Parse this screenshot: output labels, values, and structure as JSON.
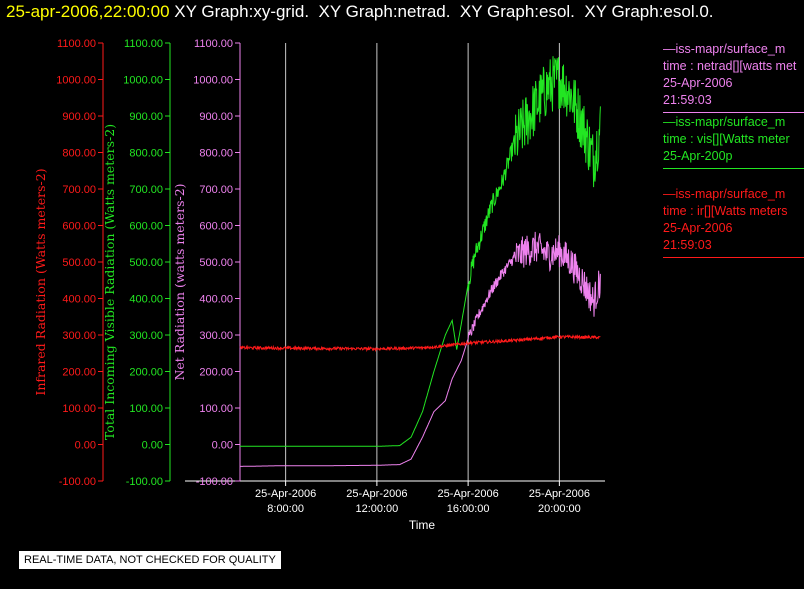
{
  "header": {
    "timestamp": "25-apr-2006,22:00:00",
    "graphs": " XY Graph:xy-grid.  XY Graph:netrad.  XY Graph:esol.  XY Graph:esol.0."
  },
  "colors": {
    "red": "#ff1a1a",
    "green": "#22e622",
    "violet": "#ee82ee",
    "grid": "#c8c8c8",
    "white": "#ffffff",
    "yellow": "#ffff00"
  },
  "chart_data": {
    "type": "line",
    "x_label": "Time",
    "x_ticks": [
      {
        "date": "25-Apr-2006",
        "time": "8:00:00",
        "hour": 8
      },
      {
        "date": "25-Apr-2006",
        "time": "12:00:00",
        "hour": 12
      },
      {
        "date": "25-Apr-2006",
        "time": "16:00:00",
        "hour": 16
      },
      {
        "date": "25-Apr-2006",
        "time": "20:00:00",
        "hour": 20
      }
    ],
    "xlim_hours": [
      6,
      22
    ],
    "axes": [
      {
        "id": "ir",
        "label": "Infrared Radiation (Watts meters-2)",
        "color": "#ff1a1a",
        "ylim": [
          -100,
          1100
        ],
        "ticks": [
          "-100.00",
          "0.00",
          "100.00",
          "200.00",
          "300.00",
          "400.00",
          "500.00",
          "600.00",
          "700.00",
          "800.00",
          "900.00",
          "1000.00",
          "1100.00"
        ]
      },
      {
        "id": "vis",
        "label": "Total Incoming Visible Radiation (Watts meters-2)",
        "color": "#22e622",
        "ylim": [
          -100,
          1100
        ],
        "ticks": [
          "-100.00",
          "0.00",
          "100.00",
          "200.00",
          "300.00",
          "400.00",
          "500.00",
          "600.00",
          "700.00",
          "800.00",
          "900.00",
          "1000.00",
          "1100.00"
        ]
      },
      {
        "id": "net",
        "label": "Net Radiation (watts meters-2)",
        "color": "#ee82ee",
        "ylim": [
          -100,
          1100
        ],
        "ticks": [
          "-100.00",
          "0.00",
          "100.00",
          "200.00",
          "300.00",
          "400.00",
          "500.00",
          "600.00",
          "700.00",
          "800.00",
          "900.00",
          "1000.00",
          "1100.00"
        ]
      }
    ],
    "series": [
      {
        "axis": "vis",
        "color": "#22e622",
        "points": [
          [
            6,
            -5
          ],
          [
            8,
            -5
          ],
          [
            10,
            -5
          ],
          [
            12,
            -5
          ],
          [
            13,
            -3
          ],
          [
            13.5,
            20
          ],
          [
            14,
            90
          ],
          [
            14.5,
            200
          ],
          [
            15,
            300
          ],
          [
            15.3,
            340
          ],
          [
            15.5,
            260
          ],
          [
            15.7,
            330
          ],
          [
            16,
            440
          ],
          [
            16.3,
            520
          ],
          [
            17,
            650
          ],
          [
            17.5,
            720
          ],
          [
            18,
            820
          ],
          [
            18.5,
            880
          ],
          [
            19,
            930
          ],
          [
            19.5,
            980
          ],
          [
            20,
            1000
          ],
          [
            20.5,
            960
          ],
          [
            21,
            880
          ],
          [
            21.5,
            780
          ],
          [
            21.8,
            870
          ],
          [
            22,
            880
          ]
        ],
        "noise": [
          [
            6,
            16,
            0
          ],
          [
            16,
            18,
            25
          ],
          [
            18,
            22,
            80
          ]
        ]
      },
      {
        "axis": "net",
        "color": "#ee82ee",
        "points": [
          [
            6,
            -60
          ],
          [
            8,
            -58
          ],
          [
            10,
            -58
          ],
          [
            12,
            -57
          ],
          [
            13,
            -55
          ],
          [
            13.5,
            -40
          ],
          [
            14,
            20
          ],
          [
            14.5,
            90
          ],
          [
            15,
            120
          ],
          [
            15.3,
            180
          ],
          [
            15.7,
            230
          ],
          [
            16,
            290
          ],
          [
            16.5,
            360
          ],
          [
            17,
            420
          ],
          [
            17.5,
            470
          ],
          [
            18,
            510
          ],
          [
            18.5,
            530
          ],
          [
            19,
            540
          ],
          [
            19.5,
            520
          ],
          [
            20,
            530
          ],
          [
            20.5,
            500
          ],
          [
            21,
            450
          ],
          [
            21.5,
            390
          ],
          [
            21.8,
            450
          ],
          [
            22,
            480
          ]
        ],
        "noise": [
          [
            6,
            16,
            0
          ],
          [
            16,
            18,
            15
          ],
          [
            18,
            22,
            45
          ]
        ]
      },
      {
        "axis": "ir",
        "color": "#ff1a1a",
        "points": [
          [
            6,
            265
          ],
          [
            10,
            263
          ],
          [
            12,
            262
          ],
          [
            14,
            265
          ],
          [
            15,
            270
          ],
          [
            16,
            278
          ],
          [
            18,
            285
          ],
          [
            20,
            295
          ],
          [
            22,
            293
          ]
        ],
        "noise": [
          [
            6,
            22,
            4
          ]
        ]
      }
    ]
  },
  "legend": [
    {
      "color": "#ee82ee",
      "lines": [
        "—iss-mapr/surface_m",
        "time : netrad[][watts met",
        "25-Apr-2006",
        "21:59:03"
      ]
    },
    {
      "color": "#22e622",
      "lines": [
        "—iss-mapr/surface_m",
        "time : vis[][Watts meter",
        "25-Apr-200p"
      ]
    },
    {
      "color": "#ff1a1a",
      "lines": [
        "—iss-mapr/surface_m",
        "time : ir[][Watts meters",
        "25-Apr-2006",
        "21:59:03"
      ]
    }
  ],
  "disclaimer": "REAL-TIME DATA, NOT CHECKED FOR QUALITY"
}
